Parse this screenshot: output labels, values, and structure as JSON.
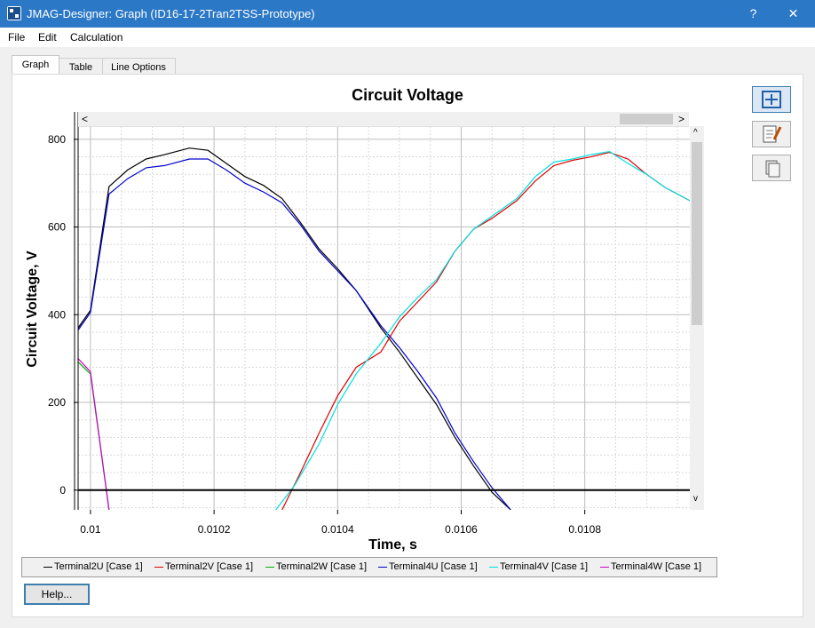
{
  "window": {
    "title": "JMAG-Designer: Graph (ID16-17-2Tran2TSS-Prototype)",
    "help_glyph": "?",
    "close_glyph": "✕"
  },
  "menu": [
    "File",
    "Edit",
    "Calculation"
  ],
  "tabs": [
    "Graph",
    "Table",
    "Line Options"
  ],
  "side_buttons": [
    "zoom-fit-icon",
    "edit-notes-icon",
    "copy-icon"
  ],
  "scroll": {
    "left": "<",
    "right": ">",
    "up": "^",
    "down": "v"
  },
  "help_button": "Help...",
  "chart_data": {
    "type": "line",
    "title": "Circuit Voltage",
    "xlabel": "Time, s",
    "ylabel": "Circuit Voltage, V",
    "xlim": [
      0.00998,
      0.01097
    ],
    "ylim": [
      -45,
      830
    ],
    "x_ticks": [
      0.01,
      0.0102,
      0.0104,
      0.0106,
      0.0108
    ],
    "x_tick_labels": [
      "0.01",
      "0.0102",
      "0.0104",
      "0.0106",
      "0.0108"
    ],
    "y_ticks": [
      0,
      200,
      400,
      600,
      800
    ],
    "y_tick_labels": [
      "0",
      "200",
      "400",
      "600",
      "800"
    ],
    "grid": true,
    "legend_placement": "bottom",
    "series": [
      {
        "name": "Terminal2U [Case 1]",
        "color": "#000000",
        "x": [
          0.00998,
          0.01,
          0.01003,
          0.01006,
          0.01009,
          0.01012,
          0.01016,
          0.01019,
          0.01022,
          0.01025,
          0.01028,
          0.01031,
          0.01034,
          0.01037,
          0.0104,
          0.01043,
          0.01047,
          0.0105,
          0.01053,
          0.01056,
          0.01059,
          0.01062,
          0.01065,
          0.01068
        ],
        "y": [
          370,
          410,
          692,
          730,
          755,
          765,
          780,
          775,
          745,
          715,
          695,
          665,
          610,
          550,
          505,
          455,
          370,
          315,
          255,
          195,
          120,
          55,
          -5,
          -45
        ]
      },
      {
        "name": "Terminal2V [Case 1]",
        "color": "#e00000",
        "x": [
          0.01031,
          0.01034,
          0.01037,
          0.0104,
          0.01043,
          0.01047,
          0.0105,
          0.01053,
          0.01056,
          0.01059,
          0.01062,
          0.01065,
          0.01069,
          0.01072,
          0.01075,
          0.01078,
          0.01081,
          0.01084,
          0.01087,
          0.0109,
          0.01093,
          0.01097
        ],
        "y": [
          -45,
          40,
          130,
          215,
          280,
          315,
          385,
          430,
          475,
          545,
          595,
          620,
          660,
          705,
          740,
          752,
          760,
          770,
          755,
          720,
          690,
          660
        ]
      },
      {
        "name": "Terminal2W [Case 1]",
        "color": "#00b000",
        "x": [
          0.00998,
          0.01,
          0.01003
        ],
        "y": [
          292,
          265,
          -45
        ]
      },
      {
        "name": "Terminal4U [Case 1]",
        "color": "#0000cc",
        "x": [
          0.00998,
          0.01,
          0.01003,
          0.01006,
          0.01009,
          0.01012,
          0.01016,
          0.01019,
          0.01022,
          0.01025,
          0.01028,
          0.01031,
          0.01034,
          0.01037,
          0.0104,
          0.01043,
          0.01047,
          0.0105,
          0.01053,
          0.01056,
          0.01059,
          0.01062,
          0.01065,
          0.01068
        ],
        "y": [
          365,
          405,
          675,
          710,
          735,
          740,
          755,
          755,
          730,
          700,
          680,
          655,
          605,
          545,
          500,
          455,
          375,
          325,
          270,
          210,
          130,
          65,
          5,
          -45
        ]
      },
      {
        "name": "Terminal4V [Case 1]",
        "color": "#00e0e0",
        "x": [
          0.0103,
          0.01033,
          0.01037,
          0.0104,
          0.01043,
          0.01047,
          0.0105,
          0.01053,
          0.01056,
          0.01059,
          0.01062,
          0.01065,
          0.01069,
          0.01072,
          0.01075,
          0.01078,
          0.01081,
          0.01084,
          0.01087,
          0.0109,
          0.01093,
          0.01097
        ],
        "y": [
          -45,
          10,
          105,
          195,
          265,
          335,
          395,
          440,
          480,
          545,
          595,
          625,
          665,
          715,
          748,
          755,
          765,
          772,
          745,
          720,
          690,
          660
        ]
      },
      {
        "name": "Terminal4W [Case 1]",
        "color": "#cc00cc",
        "x": [
          0.00998,
          0.01,
          0.01003
        ],
        "y": [
          300,
          270,
          -45
        ]
      }
    ]
  }
}
